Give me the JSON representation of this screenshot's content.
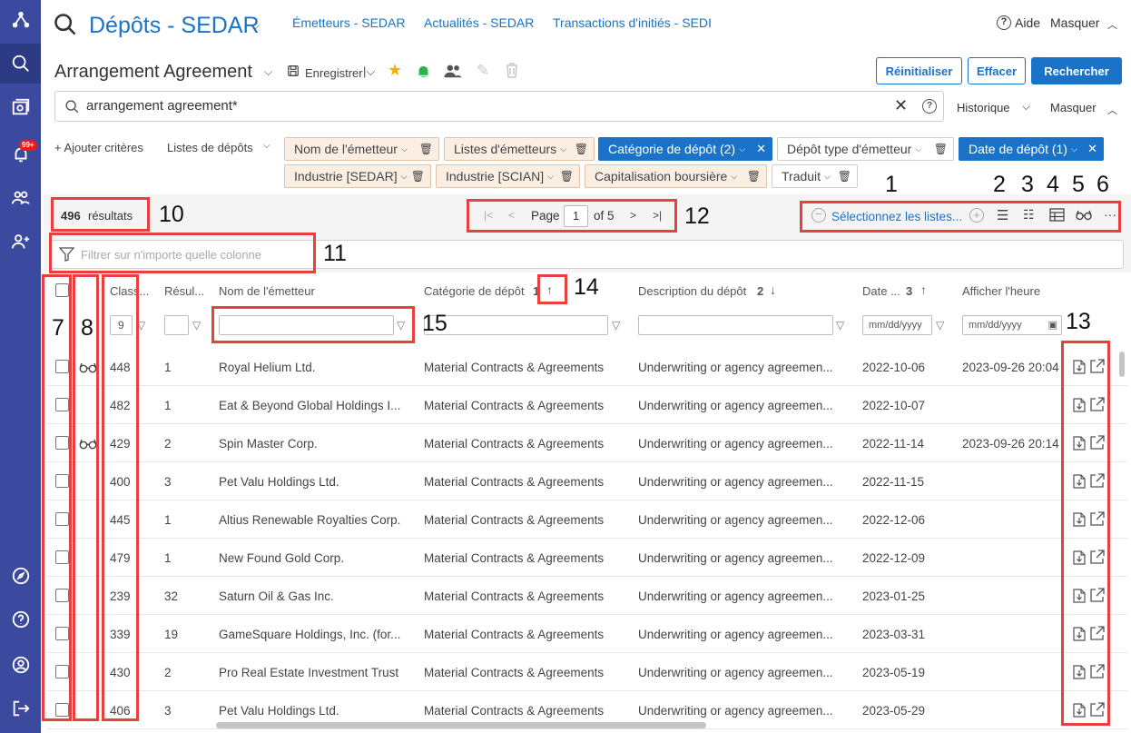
{
  "app": {
    "title": "Dépôts - SEDAR",
    "nav_links": [
      "Émetteurs - SEDAR",
      "Actualités - SEDAR",
      "Transactions d'initiés - SEDI"
    ],
    "help_label": "Aide",
    "hide_label": "Masquer",
    "notifications_badge": "99+"
  },
  "search": {
    "saved_name": "Arrangement Agreement",
    "save_label": "Enregistrer",
    "query": "arrangement agreement*",
    "history_label": "Historique",
    "hide_label": "Masquer",
    "reset_label": "Réinitialiser",
    "clear_label": "Effacer",
    "search_label": "Rechercher"
  },
  "criteria": {
    "add_label": "+ Ajouter critères",
    "lists_label": "Listes de dépôts",
    "chips": [
      {
        "label": "Nom de l'émetteur",
        "style": "beige"
      },
      {
        "label": "Listes d'émetteurs",
        "style": "beige"
      },
      {
        "label": "Catégorie de dépôt (2)",
        "style": "blue"
      },
      {
        "label": "Dépôt type d'émetteur",
        "style": "plain"
      },
      {
        "label": "Date de dépôt (1)",
        "style": "blue"
      },
      {
        "label": "Industrie [SEDAR]",
        "style": "beige"
      },
      {
        "label": "Industrie [SCIAN]",
        "style": "beige"
      },
      {
        "label": "Capitalisation boursière",
        "style": "beige"
      },
      {
        "label": "Traduit",
        "style": "plain"
      }
    ]
  },
  "results": {
    "count": "496",
    "count_label": "résultats",
    "page_label": "Page",
    "page": "1",
    "of_label": "of 5",
    "select_lists": "Sélectionnez les listes...",
    "filter_placeholder": "Filtrer sur n'importe quelle colonne",
    "filter_class_value": "9"
  },
  "table": {
    "headers": {
      "class": "Class...",
      "results": "Résul...",
      "issuer": "Nom de l'émetteur",
      "category": "Catégorie de dépôt",
      "category_sort": "1",
      "description": "Description du dépôt",
      "description_sort": "2",
      "date": "Date ...",
      "date_sort": "3",
      "time": "Afficher l'heure"
    },
    "date_placeholder": "mm/dd/yyyy",
    "rows": [
      {
        "glasses": true,
        "class": "448",
        "results": "1",
        "issuer": "Royal Helium Ltd.",
        "category": "Material Contracts & Agreements",
        "description": "Underwriting or agency agreemen...",
        "date": "2022-10-06",
        "time": "2023-09-26 20:04"
      },
      {
        "glasses": false,
        "class": "482",
        "results": "1",
        "issuer": "Eat & Beyond Global Holdings I...",
        "category": "Material Contracts & Agreements",
        "description": "Underwriting or agency agreemen...",
        "date": "2022-10-07",
        "time": ""
      },
      {
        "glasses": true,
        "class": "429",
        "results": "2",
        "issuer": "Spin Master Corp.",
        "category": "Material Contracts & Agreements",
        "description": "Underwriting or agency agreemen...",
        "date": "2022-11-14",
        "time": "2023-09-26 20:14"
      },
      {
        "glasses": false,
        "class": "400",
        "results": "3",
        "issuer": "Pet Valu Holdings Ltd.",
        "category": "Material Contracts & Agreements",
        "description": "Underwriting or agency agreemen...",
        "date": "2022-11-15",
        "time": ""
      },
      {
        "glasses": false,
        "class": "445",
        "results": "1",
        "issuer": "Altius Renewable Royalties Corp.",
        "category": "Material Contracts & Agreements",
        "description": "Underwriting or agency agreemen...",
        "date": "2022-12-06",
        "time": ""
      },
      {
        "glasses": false,
        "class": "479",
        "results": "1",
        "issuer": "New Found Gold Corp.",
        "category": "Material Contracts & Agreements",
        "description": "Underwriting or agency agreemen...",
        "date": "2022-12-09",
        "time": ""
      },
      {
        "glasses": false,
        "class": "239",
        "results": "32",
        "issuer": "Saturn Oil & Gas Inc.",
        "category": "Material Contracts & Agreements",
        "description": "Underwriting or agency agreemen...",
        "date": "2023-01-25",
        "time": ""
      },
      {
        "glasses": false,
        "class": "339",
        "results": "19",
        "issuer": "GameSquare Holdings, Inc. (for...",
        "category": "Material Contracts & Agreements",
        "description": "Underwriting or agency agreemen...",
        "date": "2023-03-31",
        "time": ""
      },
      {
        "glasses": false,
        "class": "430",
        "results": "2",
        "issuer": "Pro Real Estate Investment Trust",
        "category": "Material Contracts & Agreements",
        "description": "Underwriting or agency agreemen...",
        "date": "2023-05-19",
        "time": ""
      },
      {
        "glasses": false,
        "class": "406",
        "results": "3",
        "issuer": "Pet Valu Holdings Ltd.",
        "category": "Material Contracts & Agreements",
        "description": "Underwriting or agency agreemen...",
        "date": "2023-05-29",
        "time": ""
      }
    ]
  },
  "annotations": [
    "1",
    "2",
    "3",
    "4",
    "5",
    "6",
    "7",
    "8",
    "9",
    "10",
    "11",
    "12",
    "13",
    "14",
    "15"
  ],
  "colors": {
    "accent": "#1a73c8",
    "rail": "#3b4a9e",
    "annotation": "#e8403f"
  }
}
